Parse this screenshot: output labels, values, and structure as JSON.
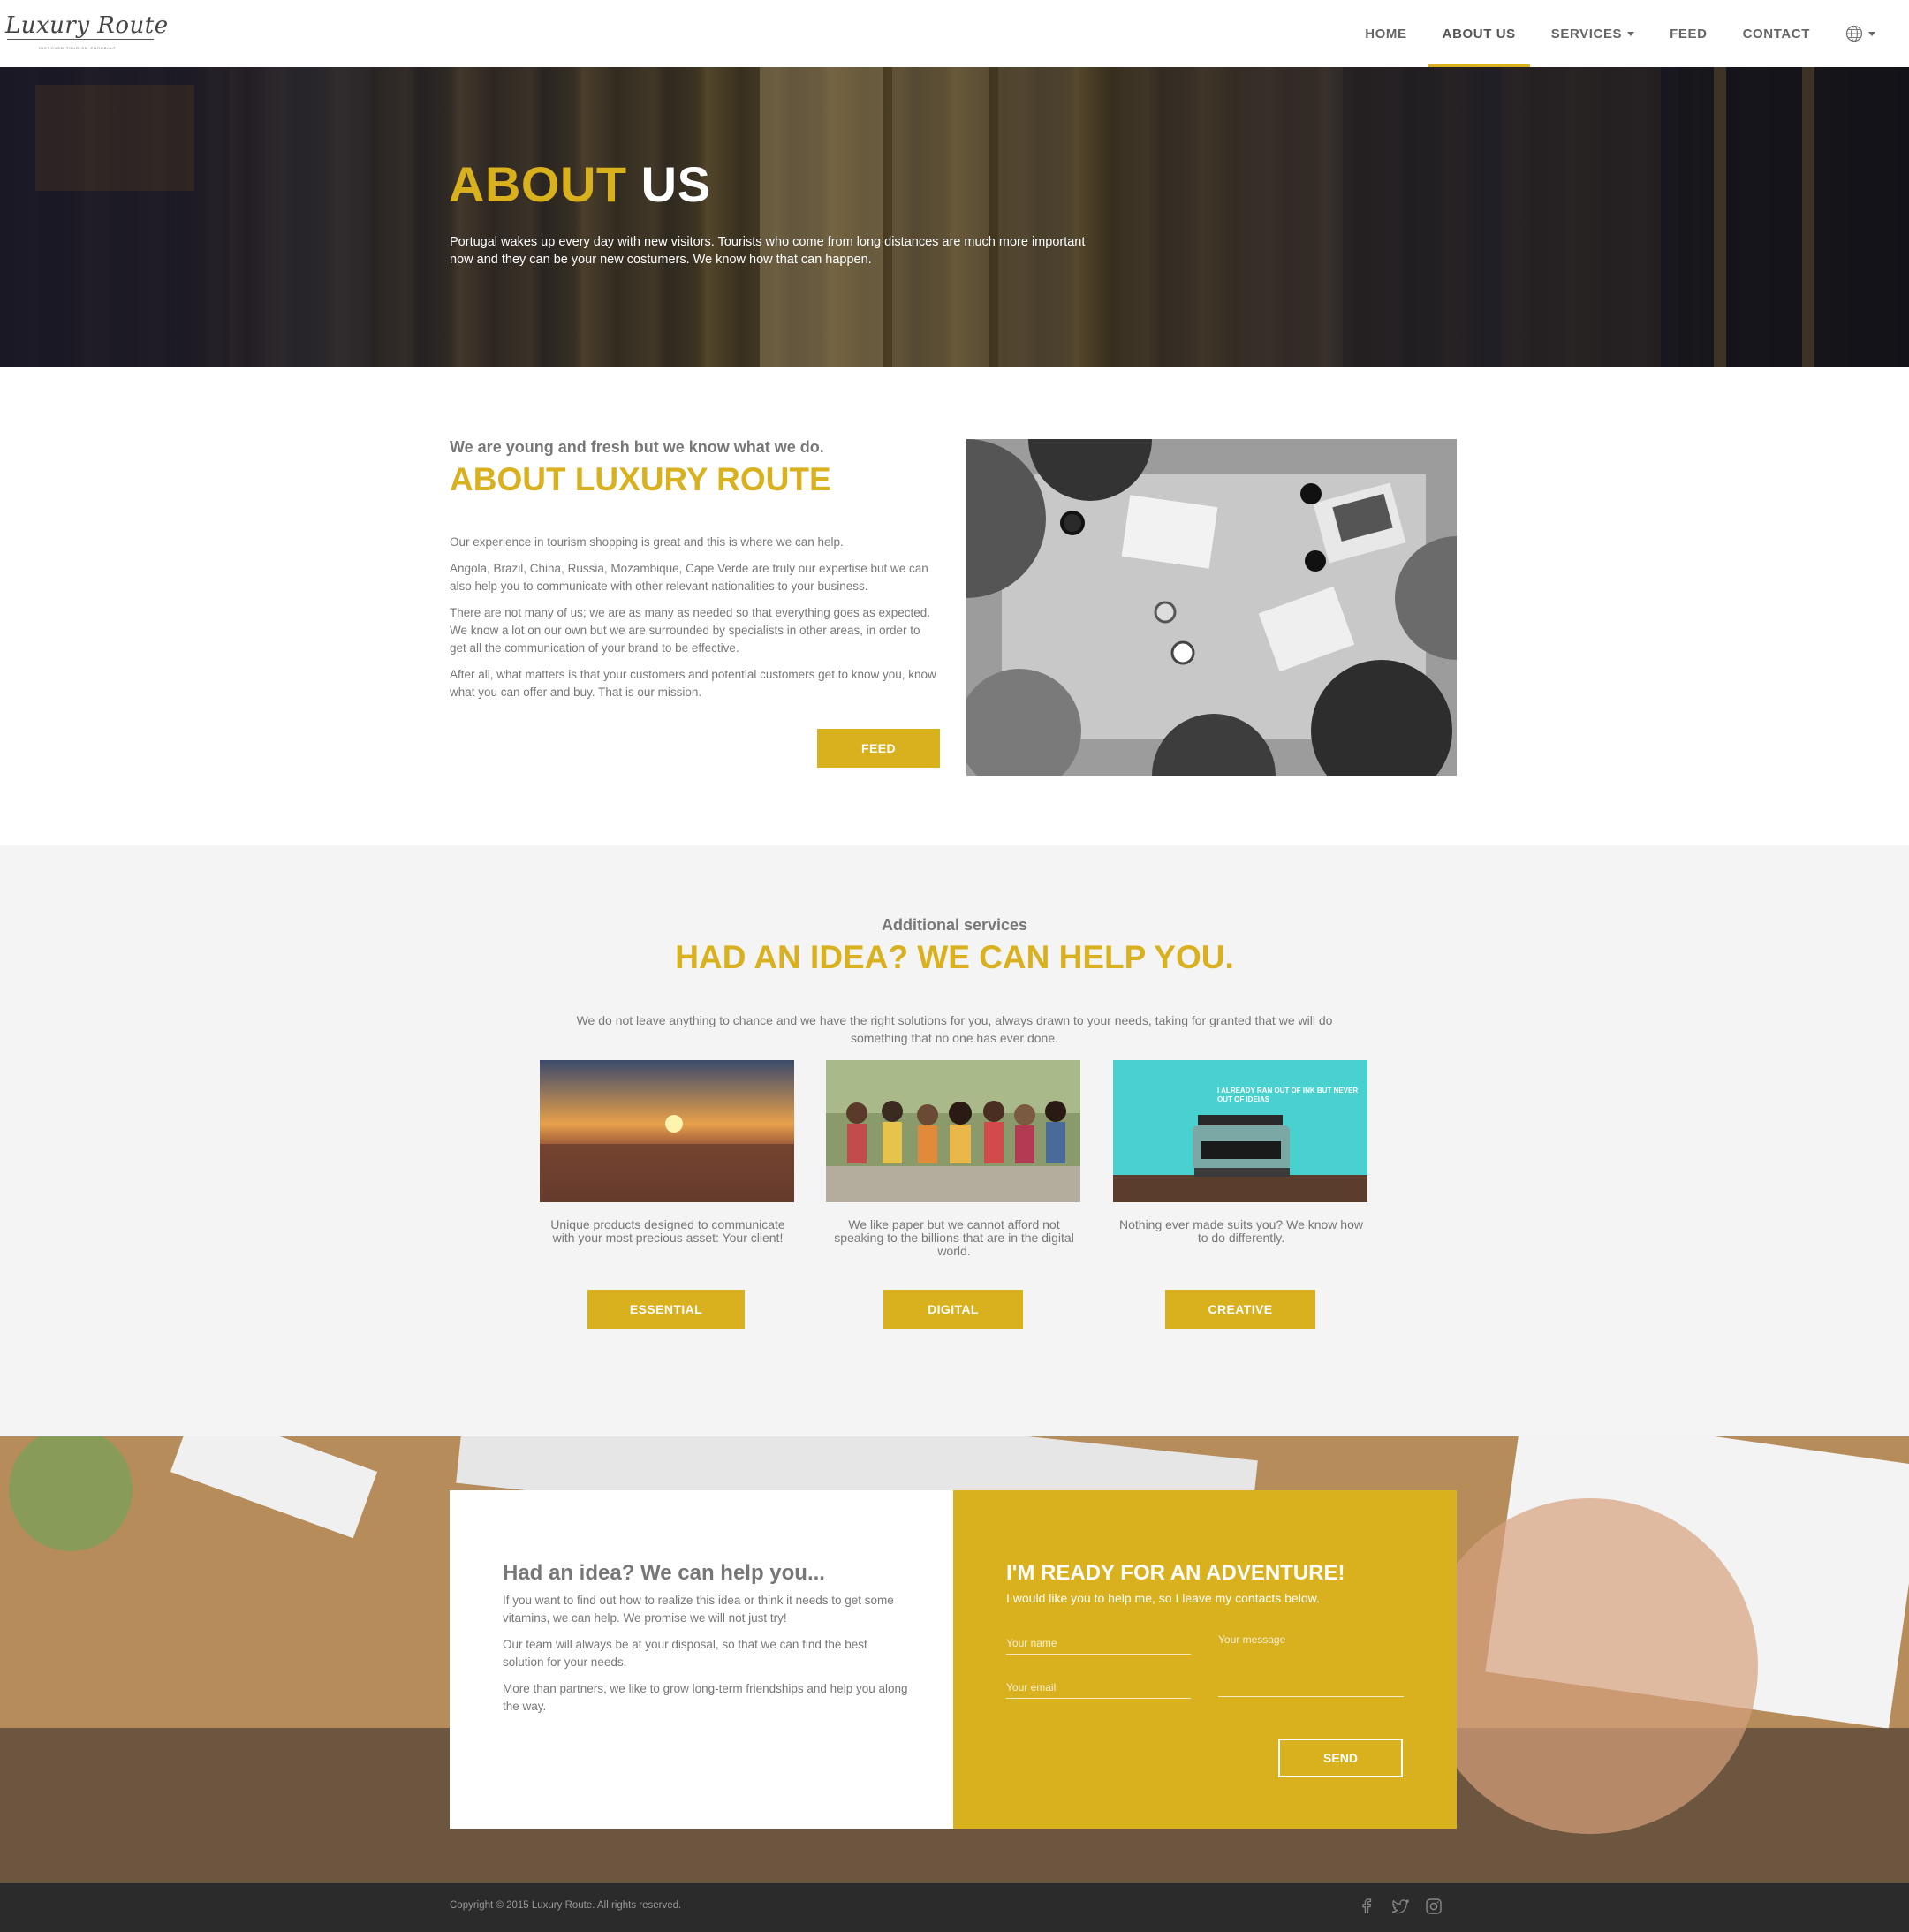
{
  "brand": {
    "name": "Luxury Route",
    "tagline": "DISCOVER TOURISM SHOPPING"
  },
  "nav": {
    "items": [
      {
        "label": "HOME"
      },
      {
        "label": "ABOUT US"
      },
      {
        "label": "SERVICES"
      },
      {
        "label": "FEED"
      },
      {
        "label": "CONTACT"
      }
    ],
    "active": "ABOUT US",
    "language_icon": "globe-icon"
  },
  "hero": {
    "title_highlight": "ABOUT",
    "title_rest": "US",
    "text": "Portugal wakes up every day with new visitors. Tourists who come from long distances are much more important now and they can be your new costumers. We know how that can happen."
  },
  "about": {
    "subtitle": "We are young and fresh but we know what we do.",
    "title": "ABOUT LUXURY ROUTE",
    "paragraphs": [
      "Our experience in tourism shopping is great and this is where we can help.",
      "Angola, Brazil, China, Russia, Mozambique, Cape Verde are truly our expertise but we can also help you to communicate with other relevant nationalities to your business.",
      "There are not many of us; we are as many as needed so that everything goes as expected. We know a lot on our own but we are surrounded by specialists in other areas, in order to get all the communication of your brand to be effective.",
      "After all, what matters is that your customers and potential customers get to know you, know what you can offer and buy. That is our mission."
    ],
    "button_label": "FEED"
  },
  "services": {
    "subtitle": "Additional services",
    "title": "HAD AN IDEA? WE CAN HELP YOU.",
    "description": "We do not leave anything to chance and we have the right solutions for you, always drawn to your needs, taking for granted that we will do something that no one has ever done.",
    "cards": [
      {
        "text": "Unique products designed to communicate with your most precious asset: Your client!",
        "button": "ESSENTIAL"
      },
      {
        "text": "We like paper but we cannot afford not speaking to the billions that are in the digital world.",
        "button": "DIGITAL"
      },
      {
        "text": "Nothing ever made suits you? We know how to do differently.",
        "button": "CREATIVE"
      }
    ],
    "typewriter_caption": "I ALREADY RAN OUT OF INK BUT NEVER OUT OF IDEIAS"
  },
  "contact": {
    "left_title": "Had an idea? We can help you...",
    "left_paragraphs": [
      "If you want to find out how to realize this idea or think it needs to get some vitamins, we can help. We promise we will not just try!",
      "Our team will always be at your disposal, so that we can find the best solution for your needs.",
      "More than partners, we like to grow long-term friendships and help you along the way."
    ],
    "right_title": "I'M READY FOR AN ADVENTURE!",
    "right_subtitle": "I would like you to help me, so I leave my contacts below.",
    "name_placeholder": "Your name",
    "email_placeholder": "Your email",
    "message_placeholder": "Your message",
    "send_label": "SEND"
  },
  "footer": {
    "copyright": "Copyright © 2015 Luxury Route. All rights reserved.",
    "social": [
      "facebook-icon",
      "twitter-icon",
      "instagram-icon"
    ]
  },
  "colors": {
    "accent": "#d9b01e",
    "text": "#777777",
    "footer_bg": "#2b2b2b",
    "section_bg": "#f4f4f4"
  }
}
